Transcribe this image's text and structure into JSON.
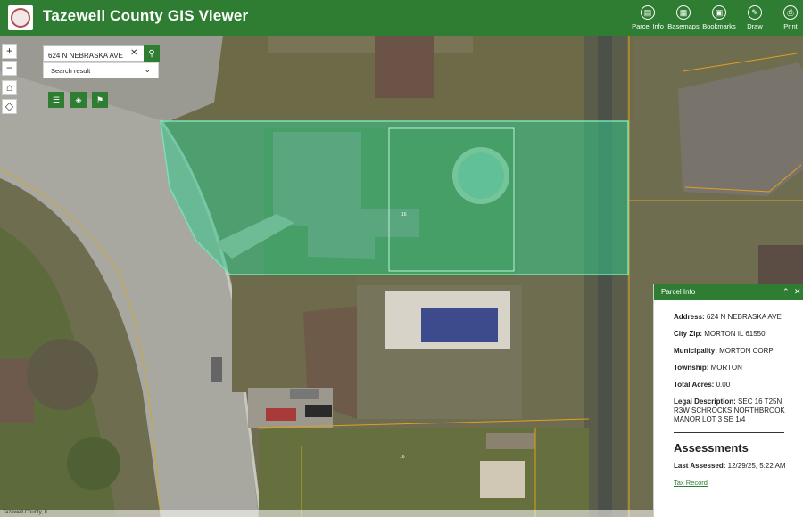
{
  "app": {
    "title": "Tazewell County GIS Viewer",
    "accent_color": "#2e7d32"
  },
  "toolbar": [
    {
      "label": "Parcel Info",
      "icon": "parcel-info-icon",
      "glyph": "▤"
    },
    {
      "label": "Basemaps",
      "icon": "basemaps-icon",
      "glyph": "▦"
    },
    {
      "label": "Bookmarks",
      "icon": "bookmarks-icon",
      "glyph": "▣"
    },
    {
      "label": "Draw",
      "icon": "draw-icon",
      "glyph": "✎"
    },
    {
      "label": "Print",
      "icon": "print-icon",
      "glyph": "⎙"
    }
  ],
  "map_controls": {
    "zoom_in": "+",
    "zoom_out": "−",
    "home": "⌂",
    "locate": "◇"
  },
  "search": {
    "value": "624 N NEBRASKA AVE",
    "clear_glyph": "✕",
    "go_glyph": "⚲",
    "result_label": "Search result",
    "result_chevron": "⌄"
  },
  "widgets": [
    {
      "icon": "list-icon",
      "glyph": "☰"
    },
    {
      "icon": "layers-icon",
      "glyph": "◈"
    },
    {
      "icon": "legend-icon",
      "glyph": "⚑"
    }
  ],
  "parcel_panel": {
    "title": "Parcel Info",
    "collapse_glyph": "⌃",
    "close_glyph": "✕",
    "fields": [
      {
        "label": "Address:",
        "value": "624 N NEBRASKA AVE"
      },
      {
        "label": "City Zip:",
        "value": "MORTON IL 61550"
      },
      {
        "label": "Municipality:",
        "value": "MORTON CORP"
      },
      {
        "label": "Township:",
        "value": "MORTON"
      },
      {
        "label": "Total Acres:",
        "value": "0.00"
      },
      {
        "label": "Legal Description:",
        "value": "SEC 16 T25N R3W SCHROCKS NORTHBROOK MANOR LOT 3 SE 1/4"
      }
    ],
    "assessments_title": "Assessments",
    "last_assessed_label": "Last Assessed:",
    "last_assessed_value": "12/29/25, 5:22 AM",
    "tax_record_link": "Tax Record"
  },
  "attribution": "Tazewell County, IL",
  "map_labels": {
    "lot_16a": "16",
    "lot_16b": "16"
  }
}
